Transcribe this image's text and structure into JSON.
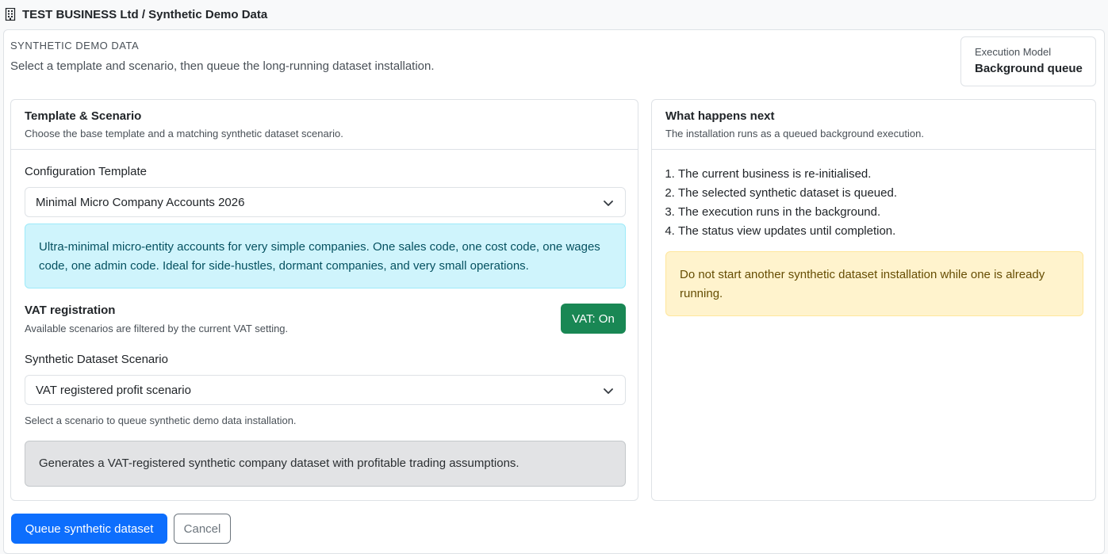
{
  "topbar": {
    "icon": "building-icon",
    "title": "TEST BUSINESS Ltd / Synthetic Demo Data"
  },
  "header": {
    "eyebrow": "SYNTHETIC DEMO DATA",
    "lead": "Select a template and scenario, then queue the long-running dataset installation."
  },
  "execution_model": {
    "label": "Execution Model",
    "value": "Background queue"
  },
  "template_card": {
    "title": "Template & Scenario",
    "subtitle": "Choose the base template and a matching synthetic dataset scenario.",
    "template_label": "Configuration Template",
    "template_value": "Minimal Micro Company Accounts 2026",
    "template_info": "Ultra-minimal micro-entity accounts for very simple companies. One sales code, one cost code, one wages code, one admin code. Ideal for side-hustles, dormant companies, and very small operations.",
    "vat_title": "VAT registration",
    "vat_subtitle": "Available scenarios are filtered by the current VAT setting.",
    "vat_button": "VAT: On",
    "scenario_label": "Synthetic Dataset Scenario",
    "scenario_value": "VAT registered profit scenario",
    "scenario_help": "Select a scenario to queue synthetic demo data installation.",
    "scenario_desc": "Generates a VAT-registered synthetic company dataset with profitable trading assumptions."
  },
  "next_card": {
    "title": "What happens next",
    "subtitle": "The installation runs as a queued background execution.",
    "steps": [
      "The current business is re-initialised.",
      "The selected synthetic dataset is queued.",
      "The execution runs in the background.",
      "The status view updates until completion."
    ],
    "warning": "Do not start another synthetic dataset installation while one is already running."
  },
  "actions": {
    "queue": "Queue synthetic dataset",
    "cancel": "Cancel"
  },
  "colors": {
    "primary": "#0d6efd",
    "success": "#198754",
    "info_bg": "#cff4fc",
    "warning_bg": "#fff3cd",
    "secondary_bg": "#e2e3e5"
  }
}
